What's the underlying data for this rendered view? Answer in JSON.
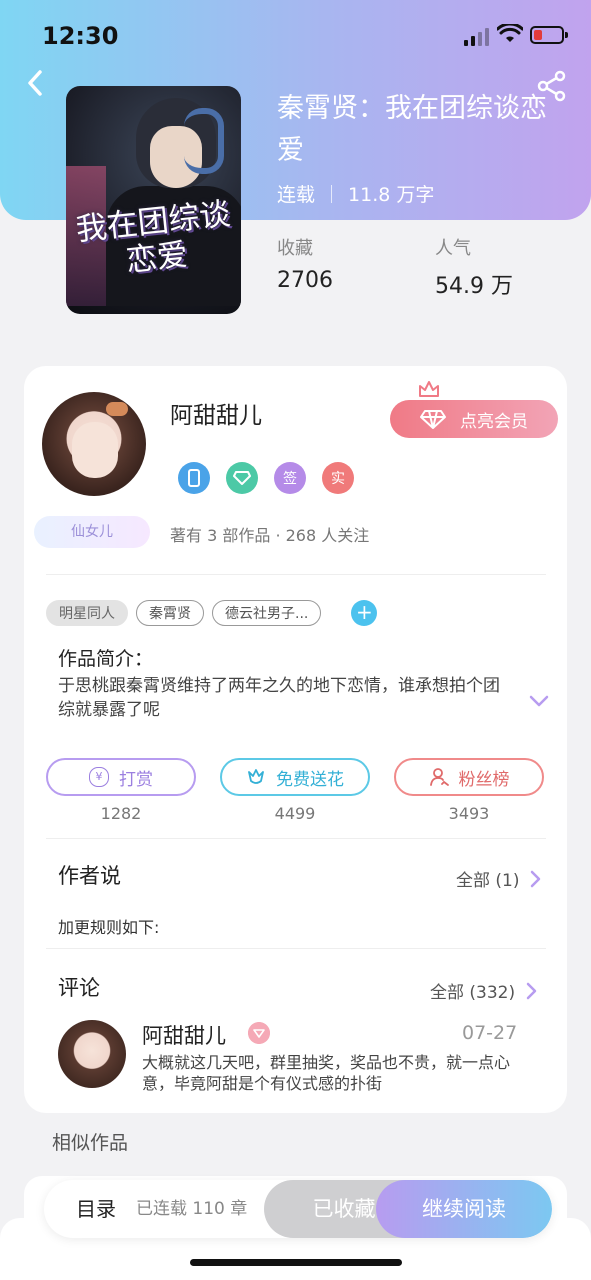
{
  "status_bar": {
    "time": "12:30"
  },
  "book": {
    "title": "秦霄贤：我在团综谈恋爱",
    "cover_text": "我在团综谈恋爱",
    "status": "连载",
    "word_count": "11.8 万字",
    "stats": [
      {
        "label": "收藏",
        "value": "2706"
      },
      {
        "label": "人气",
        "value": "54.9 万"
      }
    ]
  },
  "author": {
    "name": "阿甜甜儿",
    "fairy_badge": "仙女儿",
    "vip_button": "点亮会员",
    "badges": [
      {
        "icon": "phone-icon",
        "label": "",
        "color": "#4aa3e8"
      },
      {
        "icon": "diamond-icon",
        "label": "",
        "color": "#4cc9a6"
      },
      {
        "icon": "sign-icon",
        "label": "签",
        "color": "#b58be8"
      },
      {
        "icon": "real-name-icon",
        "label": "实",
        "color": "#f07a7a"
      }
    ],
    "works_summary": "著有 3 部作品 · 268 人关注"
  },
  "tags": [
    "明星同人",
    "秦霄贤",
    "德云社男子..."
  ],
  "intro": {
    "label": "作品简介：",
    "text": "于思桃跟秦霄贤维持了两年之久的地下恋情，谁承想拍个团综就暴露了呢"
  },
  "actions": [
    {
      "label": "打赏",
      "count": "1282",
      "icon": "yen-icon",
      "color": "#b79cf0"
    },
    {
      "label": "免费送花",
      "count": "4499",
      "icon": "flower-icon",
      "color": "#5cc9e6"
    },
    {
      "label": "粉丝榜",
      "count": "3493",
      "icon": "fans-icon",
      "color": "#f08a8a"
    }
  ],
  "author_says": {
    "title": "作者说",
    "more": "全部 (1)",
    "text": "加更规则如下:"
  },
  "comments": {
    "title": "评论",
    "more": "全部 (332)",
    "items": [
      {
        "name": "阿甜甜儿",
        "date": "07-27",
        "text": "大概就这几天吧，群里抽奖，奖品也不贵，就一点心意，毕竟阿甜是个有仪式感的扑街"
      }
    ]
  },
  "similar": {
    "title": "相似作品"
  },
  "bottom_bar": {
    "toc": "目录",
    "chapters": "已连载 110 章",
    "saved": "已收藏",
    "read": "继续阅读"
  }
}
